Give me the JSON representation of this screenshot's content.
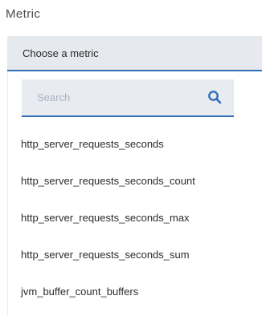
{
  "field": {
    "label": "Metric"
  },
  "select": {
    "value": "Choose a metric"
  },
  "search": {
    "placeholder": "Search",
    "value": ""
  },
  "icons": {
    "search": "search-icon"
  },
  "colors": {
    "accent": "#2f6fb8",
    "field_background": "#e6e9ee",
    "placeholder": "#a7b2c2"
  },
  "options": [
    {
      "label": "http_server_requests_seconds"
    },
    {
      "label": "http_server_requests_seconds_count"
    },
    {
      "label": "http_server_requests_seconds_max"
    },
    {
      "label": "http_server_requests_seconds_sum"
    },
    {
      "label": "jvm_buffer_count_buffers"
    }
  ]
}
